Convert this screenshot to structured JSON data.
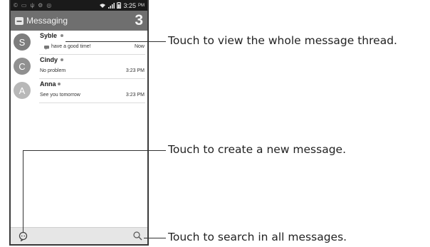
{
  "status_bar": {
    "left_icons": [
      "notif-c-icon",
      "notif-screen-icon",
      "usb-icon",
      "notif-gear-icon",
      "notif-app-icon"
    ],
    "left_glyphs": [
      "©",
      "▭",
      "ψ",
      "⚙",
      "◎"
    ],
    "time": "3:25",
    "ampm": "PM"
  },
  "app_bar": {
    "title": "Messaging",
    "count": "3"
  },
  "threads": [
    {
      "initial": "S",
      "name": "Syble",
      "snippet": "have a good time!",
      "time": "Now",
      "has_icon": true,
      "avatar_color": "#7d7d7d"
    },
    {
      "initial": "C",
      "name": "Cindy",
      "snippet": "No problem",
      "time": "3:23 PM",
      "has_icon": false,
      "avatar_color": "#909090"
    },
    {
      "initial": "A",
      "name": "Anna",
      "snippet": "See you tomorrow",
      "time": "3:23 PM",
      "has_icon": false,
      "avatar_color": "#b8b8b8"
    }
  ],
  "callouts": {
    "thread": "Touch to view the whole message thread.",
    "compose": "Touch to create a new message.",
    "search": "Touch to search in all messages."
  }
}
